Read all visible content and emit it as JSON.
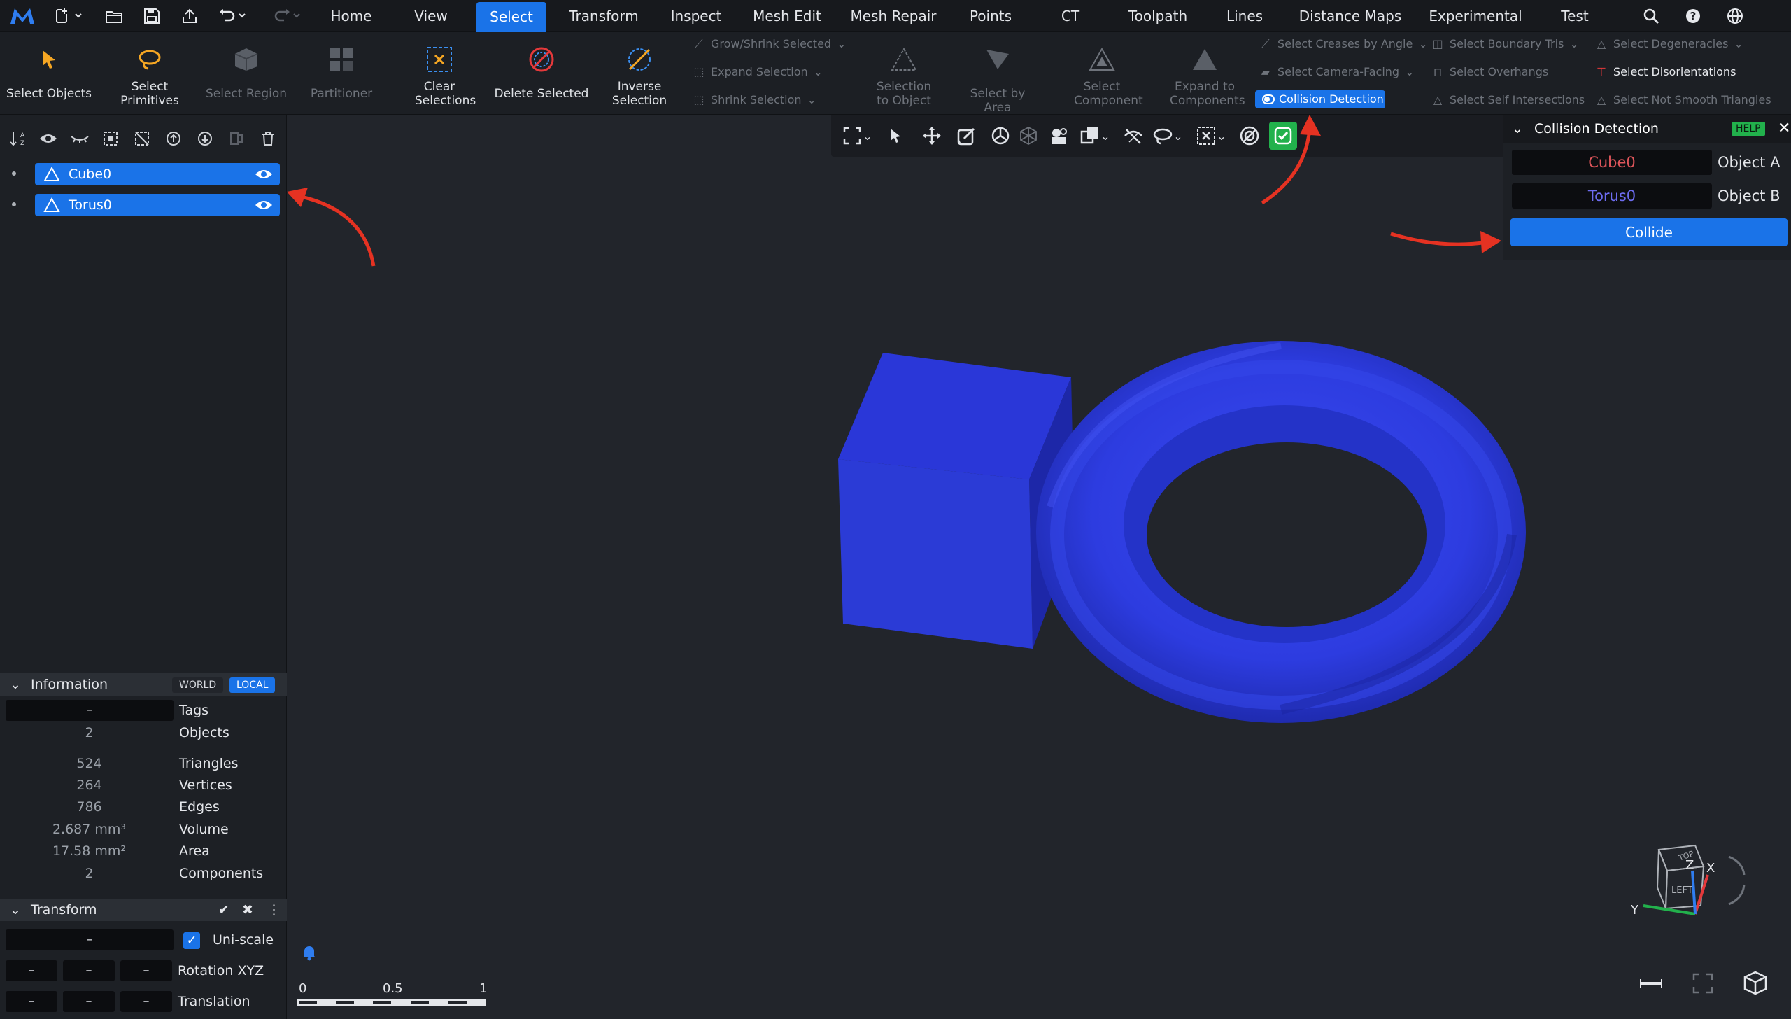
{
  "menubar": {
    "tabs": [
      "Home",
      "View",
      "Select",
      "Transform",
      "Inspect",
      "Mesh Edit",
      "Mesh Repair",
      "Points",
      "CT",
      "Toolpath",
      "Lines",
      "Distance Maps",
      "Experimental",
      "Test"
    ],
    "active_tab": "Select"
  },
  "ribbon": {
    "select_objects": "Select Objects",
    "select_primitives": "Select Primitives",
    "select_region": "Select Region",
    "partitioner": "Partitioner",
    "clear_selections": "Clear Selections",
    "delete_selected": "Delete Selected",
    "inverse_selection": "Inverse Selection",
    "grow_shrink": "Grow/Shrink Selected",
    "expand_selection": "Expand Selection",
    "shrink_selection": "Shrink Selection",
    "selection_to_object": "Selection to Object",
    "select_by_area": "Select by Area",
    "select_component": "Select Component",
    "expand_to_components": "Expand to Components",
    "select_creases": "Select Creases by Angle",
    "select_camera_facing": "Select Camera-Facing",
    "collision_detection": "Collision Detection",
    "select_boundary_tris": "Select Boundary Tris",
    "select_overhangs": "Select Overhangs",
    "select_self_intersections": "Select Self Intersections",
    "select_degeneracies": "Select Degeneracies",
    "select_disorientations": "Select Disorientations",
    "select_not_smooth": "Select Not Smooth Triangles"
  },
  "scene": {
    "items": [
      {
        "name": "Cube0"
      },
      {
        "name": "Torus0"
      }
    ]
  },
  "information": {
    "title": "Information",
    "world": "WORLD",
    "local": "LOCAL",
    "rows": [
      {
        "value": "–",
        "key": "Tags"
      },
      {
        "value": "2",
        "key": "Objects"
      },
      {
        "value": "524",
        "key": "Triangles"
      },
      {
        "value": "264",
        "key": "Vertices"
      },
      {
        "value": "786",
        "key": "Edges"
      },
      {
        "value": "2.687 mm³",
        "key": "Volume"
      },
      {
        "value": "17.58 mm²",
        "key": "Area"
      },
      {
        "value": "2",
        "key": "Components"
      }
    ]
  },
  "transform": {
    "title": "Transform",
    "uniscale_value": "–",
    "uniscale_label": "Uni-scale",
    "uniscale_checked": true,
    "rotation_label": "Rotation XYZ",
    "rotation": [
      "–",
      "–",
      "–"
    ],
    "translation_label": "Translation",
    "translation": [
      "–",
      "–",
      "–"
    ]
  },
  "collision_panel": {
    "title": "Collision Detection",
    "help": "HELP",
    "object_a_value": "Cube0",
    "object_a_label": "Object A",
    "object_b_value": "Torus0",
    "object_b_label": "Object B",
    "collide": "Collide"
  },
  "scale_bar": {
    "ticks": [
      "0",
      "0.5",
      "1"
    ]
  },
  "view_cube": {
    "top": "TOP",
    "left": "LEFT",
    "axes": [
      "X",
      "Y",
      "Z"
    ]
  },
  "colors": {
    "accent": "#1a73e8",
    "mesh": "#2b3bd6",
    "object_a": "#e0565b",
    "object_b": "#6d6cf0",
    "help": "#22b14c",
    "annotation": "#e53222"
  }
}
